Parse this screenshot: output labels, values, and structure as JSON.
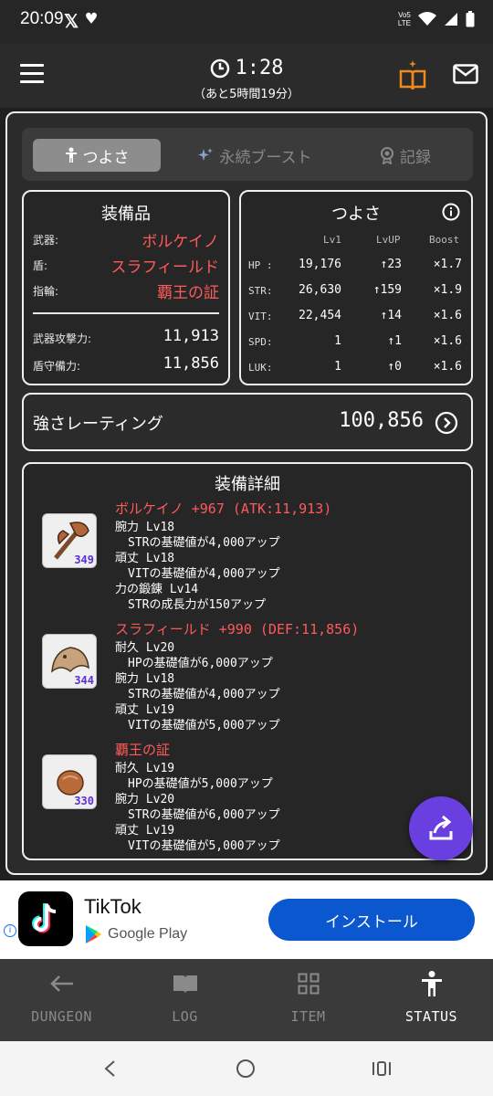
{
  "status_bar": {
    "time": "20:09",
    "x_glyph": "𝕏",
    "network": "Vo5\nLTE"
  },
  "header": {
    "timer": "1:28",
    "timer_sub": "（あと5時間19分）"
  },
  "tabs": [
    {
      "label": "つよさ",
      "icon": "person-icon",
      "active": true
    },
    {
      "label": "永続ブースト",
      "icon": "sparkle-icon",
      "active": false
    },
    {
      "label": "記録",
      "icon": "medal-icon",
      "active": false
    }
  ],
  "equipment": {
    "title": "装備品",
    "items": [
      {
        "label": "武器:",
        "value": "ボルケイノ"
      },
      {
        "label": "盾:",
        "value": "スラフィールド"
      },
      {
        "label": "指輪:",
        "value": "覇王の証"
      }
    ],
    "atk_label": "武器攻撃力:",
    "atk_value": "11,913",
    "def_label": "盾守備力:",
    "def_value": "11,856"
  },
  "stats": {
    "title": "つよさ",
    "headers": [
      "Lv1",
      "LvUP",
      "Boost"
    ],
    "rows": [
      {
        "name": "HP :",
        "lv1": "19,176",
        "lvup": "↑23",
        "boost": "×1.7"
      },
      {
        "name": "STR:",
        "lv1": "26,630",
        "lvup": "↑159",
        "boost": "×1.9"
      },
      {
        "name": "VIT:",
        "lv1": "22,454",
        "lvup": "↑14",
        "boost": "×1.6"
      },
      {
        "name": "SPD:",
        "lv1": "1",
        "lvup": "↑1",
        "boost": "×1.6"
      },
      {
        "name": "LUK:",
        "lv1": "1",
        "lvup": "↑0",
        "boost": "×1.6"
      }
    ]
  },
  "rating": {
    "label": "強さレーティング",
    "value": "100,856"
  },
  "detail": {
    "title": "装備詳細",
    "items": [
      {
        "icon_level": "349",
        "name": "ボルケイノ +967 (ATK:11,913)",
        "skills": [
          {
            "text": "腕力 Lv18",
            "sub": false
          },
          {
            "text": "STRの基礎値が4,000アップ",
            "sub": true
          },
          {
            "text": "頑丈 Lv18",
            "sub": false
          },
          {
            "text": "VITの基礎値が4,000アップ",
            "sub": true
          },
          {
            "text": "力の鍛錬 Lv14",
            "sub": false
          },
          {
            "text": "STRの成長力が150アップ",
            "sub": true
          }
        ]
      },
      {
        "icon_level": "344",
        "name": "スラフィールド +990 (DEF:11,856)",
        "skills": [
          {
            "text": "耐久 Lv20",
            "sub": false
          },
          {
            "text": "HPの基礎値が6,000アップ",
            "sub": true
          },
          {
            "text": "腕力 Lv18",
            "sub": false
          },
          {
            "text": "STRの基礎値が4,000アップ",
            "sub": true
          },
          {
            "text": "頑丈 Lv19",
            "sub": false
          },
          {
            "text": "VITの基礎値が5,000アップ",
            "sub": true
          }
        ]
      },
      {
        "icon_level": "330",
        "name": "覇王の証",
        "skills": [
          {
            "text": "耐久 Lv19",
            "sub": false
          },
          {
            "text": "HPの基礎値が5,000アップ",
            "sub": true
          },
          {
            "text": "腕力 Lv20",
            "sub": false
          },
          {
            "text": "STRの基礎値が6,000アップ",
            "sub": true
          },
          {
            "text": "頑丈 Lv19",
            "sub": false
          },
          {
            "text": "VITの基礎値が5,000アップ",
            "sub": true
          }
        ]
      }
    ]
  },
  "ad": {
    "app_name": "TikTok",
    "store": "Google Play",
    "button": "インストール",
    "info": "i"
  },
  "bottom_nav": [
    {
      "label": "DUNGEON",
      "icon": "arrow-left-icon"
    },
    {
      "label": "LOG",
      "icon": "book-icon"
    },
    {
      "label": "ITEM",
      "icon": "grid-icon"
    },
    {
      "label": "STATUS",
      "icon": "person-icon",
      "active": true
    }
  ],
  "colors": {
    "accent_red": "#ff5a5a",
    "fab": "#6a3fe0",
    "ad_button": "#0b57d0",
    "book_icon": "#f08a1c"
  }
}
